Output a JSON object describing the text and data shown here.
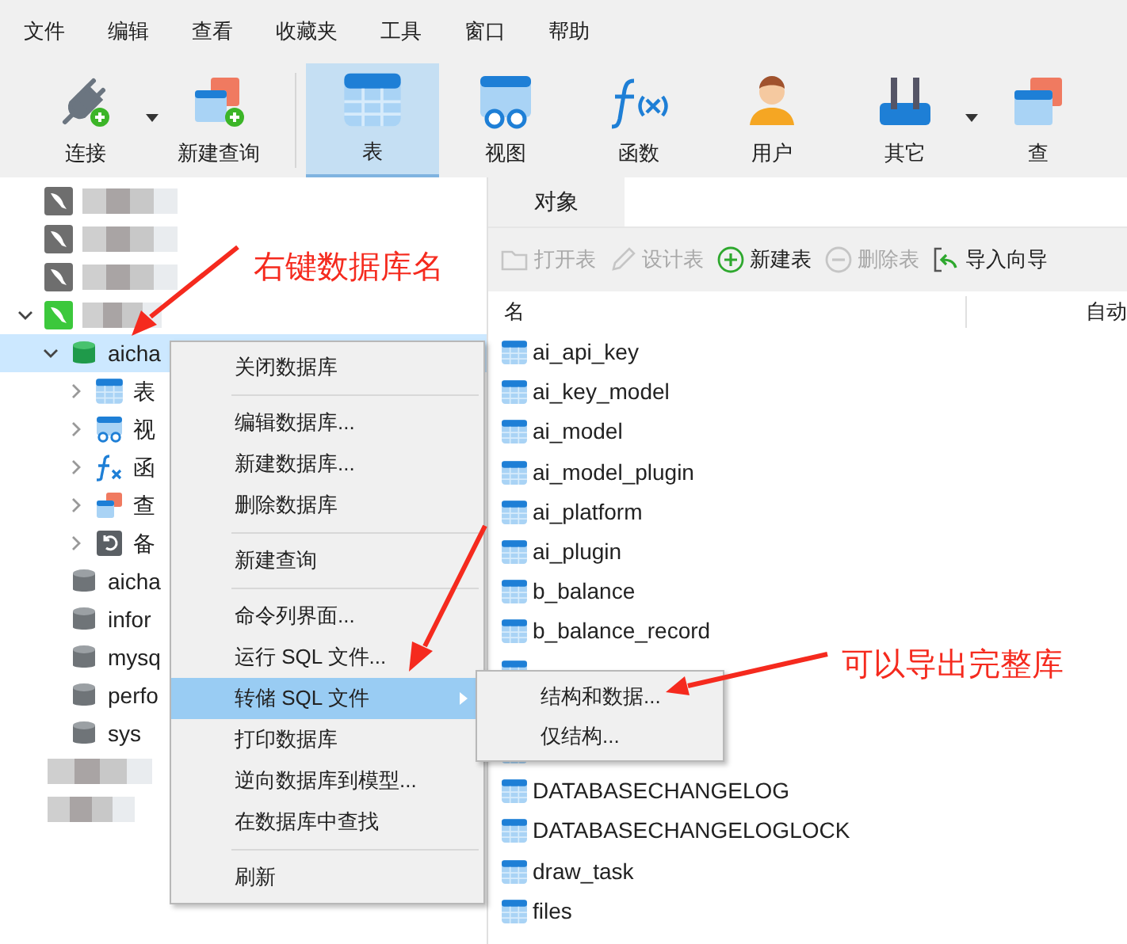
{
  "menu_bar": [
    "文件",
    "编辑",
    "查看",
    "收藏夹",
    "工具",
    "窗口",
    "帮助"
  ],
  "toolbar": [
    {
      "kind": "connect",
      "label": "连接",
      "dropdown": true,
      "selected": false
    },
    {
      "kind": "new-query",
      "label": "新建查询",
      "dropdown": false,
      "selected": false
    },
    {
      "kind": "table",
      "label": "表",
      "dropdown": false,
      "selected": true
    },
    {
      "kind": "view",
      "label": "视图",
      "dropdown": false,
      "selected": false
    },
    {
      "kind": "function",
      "label": "函数",
      "dropdown": false,
      "selected": false
    },
    {
      "kind": "user",
      "label": "用户",
      "dropdown": false,
      "selected": false
    },
    {
      "kind": "other",
      "label": "其它",
      "dropdown": true,
      "selected": false
    },
    {
      "kind": "query",
      "label": "查",
      "dropdown": false,
      "selected": false
    }
  ],
  "tree": [
    {
      "kind": "connection",
      "connected": false
    },
    {
      "kind": "connection",
      "connected": false
    },
    {
      "kind": "connection",
      "connected": false
    },
    {
      "kind": "connection",
      "connected": true,
      "children": [
        {
          "kind": "database",
          "label": "aicha",
          "open": true,
          "selected": true,
          "children": [
            {
              "kind": "tables",
              "label": "表"
            },
            {
              "kind": "views",
              "label": "视"
            },
            {
              "kind": "functions",
              "label": "函"
            },
            {
              "kind": "queries",
              "label": "查"
            },
            {
              "kind": "backups",
              "label": "备"
            }
          ]
        },
        {
          "kind": "database",
          "label": "aicha",
          "open": false,
          "selected": false
        },
        {
          "kind": "database",
          "label": "infor",
          "open": false,
          "selected": false
        },
        {
          "kind": "database",
          "label": "mysq",
          "open": false,
          "selected": false
        },
        {
          "kind": "database",
          "label": "perfo",
          "open": false,
          "selected": false
        },
        {
          "kind": "database",
          "label": "sys",
          "open": false,
          "selected": false
        }
      ]
    }
  ],
  "object_tab": {
    "label": "对象",
    "selected": true
  },
  "object_toolbar": [
    {
      "kind": "open",
      "label": "打开表",
      "disabled": true
    },
    {
      "kind": "design",
      "label": "设计表",
      "disabled": true
    },
    {
      "kind": "new",
      "label": "新建表",
      "disabled": false
    },
    {
      "kind": "delete",
      "label": "删除表",
      "disabled": true
    },
    {
      "kind": "import",
      "label": "导入向导",
      "disabled": false
    }
  ],
  "table": {
    "columns": [
      "名",
      "自动"
    ],
    "rows": [
      {
        "name": "ai_api_key"
      },
      {
        "name": "ai_key_model"
      },
      {
        "name": "ai_model"
      },
      {
        "name": "ai_model_plugin"
      },
      {
        "name": "ai_platform"
      },
      {
        "name": "ai_plugin"
      },
      {
        "name": "b_balance"
      },
      {
        "name": "b_balance_record"
      },
      {
        "hidden": true
      },
      {
        "hidden": true
      },
      {
        "name": "DATABASECHANGELOG"
      },
      {
        "name": "DATABASECHANGELOGLOCK"
      },
      {
        "name": "draw_task"
      },
      {
        "name": "files"
      }
    ]
  },
  "context_menu": [
    [
      {
        "label": "关闭数据库",
        "selected": false,
        "submenu": false
      }
    ],
    [
      {
        "label": "编辑数据库...",
        "selected": false,
        "submenu": false
      },
      {
        "label": "新建数据库...",
        "selected": false,
        "submenu": false
      },
      {
        "label": "删除数据库",
        "selected": false,
        "submenu": false
      }
    ],
    [
      {
        "label": "新建查询",
        "selected": false,
        "submenu": false
      }
    ],
    [
      {
        "label": "命令列界面...",
        "selected": false,
        "submenu": false
      },
      {
        "label": "运行 SQL 文件...",
        "selected": false,
        "submenu": false
      },
      {
        "label": "转储 SQL 文件",
        "selected": true,
        "submenu": true
      },
      {
        "label": "打印数据库",
        "selected": false,
        "submenu": false
      },
      {
        "label": "逆向数据库到模型...",
        "selected": false,
        "submenu": false
      },
      {
        "label": "在数据库中查找",
        "selected": false,
        "submenu": false
      }
    ],
    [
      {
        "label": "刷新",
        "selected": false,
        "submenu": false
      }
    ]
  ],
  "submenu": [
    "结构和数据...",
    "仅结构..."
  ],
  "annotations": [
    "右键数据库名",
    "可以导出完整库"
  ]
}
